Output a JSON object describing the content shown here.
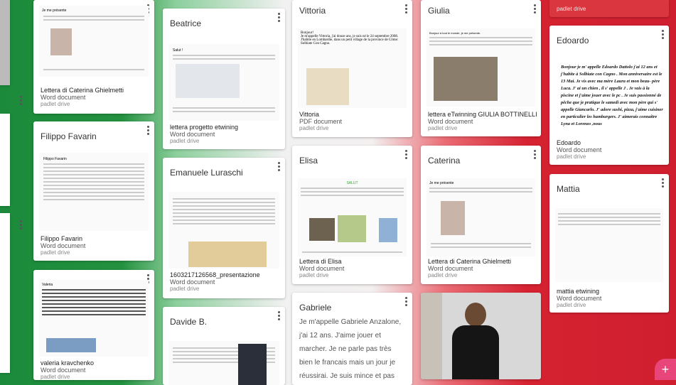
{
  "source_label": "padlet drive",
  "word_type": "Word document",
  "pdf_type": "PDF document",
  "columns": [
    {
      "cards": [
        {
          "title": "",
          "name": "Lettera di Caterina Ghielmetti",
          "heading": "Je me présente"
        },
        {
          "title": "Filippo Favarin",
          "name": "Filippo Favarin",
          "heading": "Filippo Favarin"
        },
        {
          "title": "",
          "name": "valeria kravchenko",
          "heading": "Valeria"
        }
      ]
    },
    {
      "cards": [
        {
          "title": "Beatrice",
          "name": "lettera progetto etwining",
          "heading": "Salut !"
        },
        {
          "title": "Emanuele Luraschi",
          "name": "1603217126568_presentazione",
          "heading": ""
        },
        {
          "title": "Davide B.",
          "name": "",
          "heading": ""
        }
      ]
    },
    {
      "cards": [
        {
          "title": "Vittoria",
          "name": "Vittoria",
          "heading": "Bonjour!",
          "lines": [
            "Je m'appelle Vittoria, j'ai douze ans, je suis né le 24 septembre 2008.",
            "J'habite en Lombardie, dans un petit village de la province de Côme: Solbiate Con Cagno."
          ]
        },
        {
          "title": "Elisa",
          "name": "Lettera di Elisa",
          "heading": "SALUT"
        },
        {
          "title": "Gabriele",
          "name": "",
          "body": "Je m'appelle Gabriele Anzalone, j'ai 12 ans. J'aime jouer et marcher. Je ne parle pas très bien le francais mais un jour je réussirai. Je suis mince et pas troppo grand. Mon couleur"
        }
      ]
    },
    {
      "cards": [
        {
          "title": "Giulia",
          "name": "lettera eTwinning GIULIA BOTTINELLI",
          "heading": "Bonjour à tout le monde, je me présente."
        },
        {
          "title": "Caterina",
          "name": "Lettera di Caterina Ghielmetti",
          "heading": "Je me présente"
        },
        {
          "title": "",
          "name": ""
        }
      ]
    },
    {
      "cards": [
        {
          "title": "",
          "name": ""
        },
        {
          "title": "Edoardo",
          "name": "Edoardo",
          "body": "Bonjour je m' appelle Edoardo Dattolo j'ai 12 ans et j'habite à Solbiate con Cagno . Mon anniversaire est le 13 Mai. Je vis avec ma mère Laura et mon beau- père Luca. J' ai un chien , il s' appelle J . Je vais à la piscine et j'aime jouer avec le pc . Je suis passionné de pêche que je pratique le samedi avec mon père qui s' appelle Giancarlo. J' adore sushi, pizza, j'aime cuisiner en particulier les hamburgers. J' aimerais connaître Lyna et Lorenzo ,nous"
        },
        {
          "title": "Mattia",
          "name": "mattia etwining"
        }
      ]
    }
  ],
  "fab_label": "+",
  "colors": {
    "green": "#1b8a3a",
    "red": "#d62231",
    "accent": "#e8457a"
  }
}
